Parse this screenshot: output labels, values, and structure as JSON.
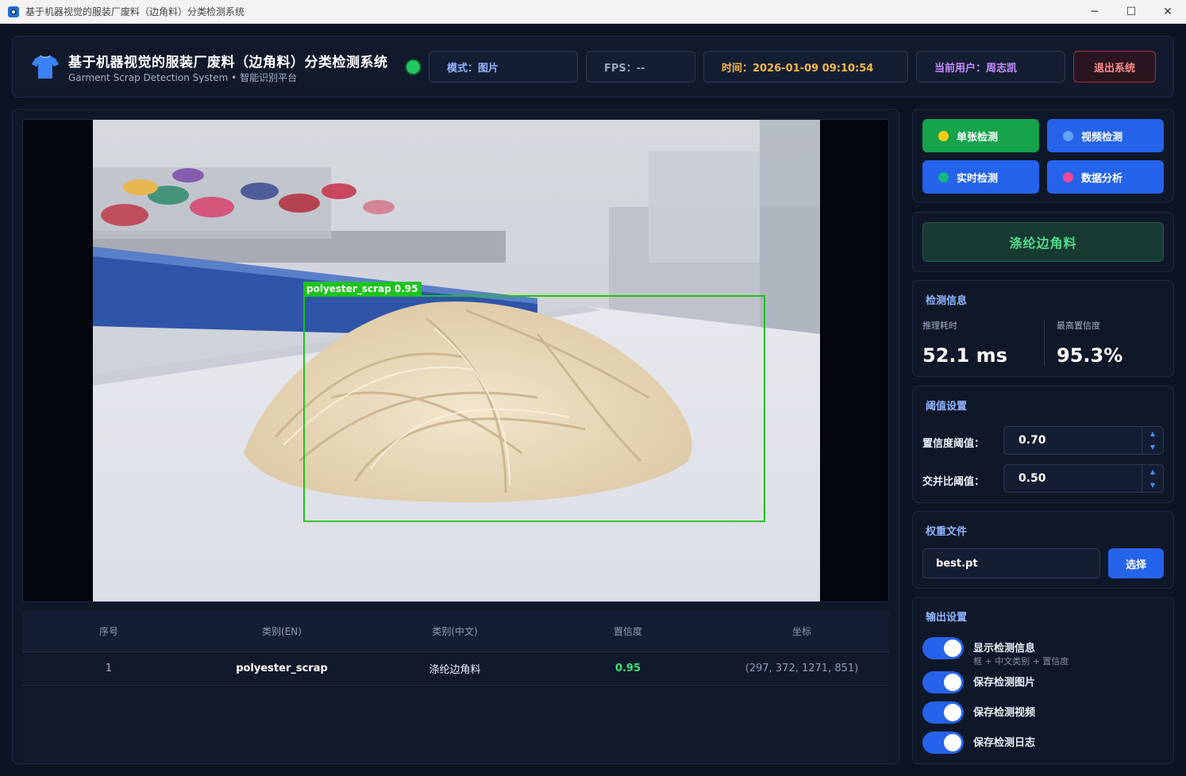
{
  "window": {
    "title": "基于机器视觉的服装厂废料（边角料）分类检测系统",
    "controls": [
      "─",
      "☐",
      "✕"
    ]
  },
  "header": {
    "title": "基于机器视觉的服装厂废料（边角料）分类检测系统",
    "subtitle": "Garment Scrap Detection System • 智能识别平台",
    "mode": "模式：图片",
    "fps": "FPS：--",
    "time": "时间：2026-01-09 09:10:54",
    "user": "当前用户：周志凯",
    "logout": "退出系统",
    "status_color": "#22c55e"
  },
  "detection": {
    "box_label": "polyester_scrap  0.95",
    "box_color": "#1ec21e"
  },
  "table": {
    "headers": [
      "序号",
      "类别(EN)",
      "类别(中文)",
      "置信度",
      "坐标"
    ],
    "rows": [
      {
        "idx": "1",
        "en": "polyester_scrap",
        "cn": "涤纶边角料",
        "conf": "0.95",
        "coord": "(297, 372, 1271, 851)"
      }
    ]
  },
  "modes": [
    {
      "label": "单张检测",
      "bg": "#16a34a",
      "dot": "#facc15"
    },
    {
      "label": "视频检测",
      "bg": "#2563eb",
      "dot": "#60a5fa"
    },
    {
      "label": "实时检测",
      "bg": "#2563eb",
      "dot": "#10b981"
    },
    {
      "label": "数据分析",
      "bg": "#2563eb",
      "dot": "#ec4899"
    }
  ],
  "result_banner": "涤纶边角料",
  "info": {
    "title": "检测信息",
    "inference_label": "推理耗时",
    "inference_value": "52.1 ms",
    "max_conf_label": "最高置信度",
    "max_conf_value": "95.3%"
  },
  "threshold": {
    "title": "阈值设置",
    "conf_label": "置信度阈值：",
    "conf_value": "0.70",
    "iou_label": "交并比阈值：",
    "iou_value": "0.50"
  },
  "weights": {
    "title": "权重文件",
    "file": "best.pt",
    "choose": "选择"
  },
  "output": {
    "title": "输出设置",
    "toggles": [
      {
        "label": "显示检测信息",
        "sub": "框 + 中文类别 + 置信度",
        "on": true
      },
      {
        "label": "保存检测图片",
        "sub": "",
        "on": true
      },
      {
        "label": "保存检测视频",
        "sub": "",
        "on": true
      },
      {
        "label": "保存检测日志",
        "sub": "",
        "on": true
      }
    ]
  }
}
